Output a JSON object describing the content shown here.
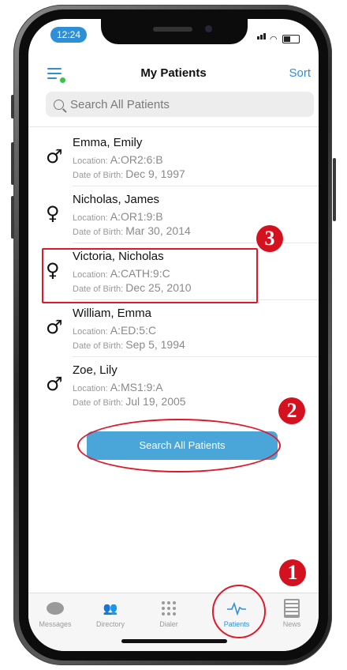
{
  "status": {
    "time": "12:24"
  },
  "header": {
    "title": "My Patients",
    "sort_label": "Sort"
  },
  "search": {
    "placeholder": "Search All Patients"
  },
  "patients": [
    {
      "sex": "male",
      "symbol": "♂",
      "name": "Emma, Emily",
      "location_label": "Location:",
      "location": "A:OR2:6:B",
      "dob_label": "Date of Birth:",
      "dob": "Dec 9, 1997"
    },
    {
      "sex": "female",
      "symbol": "♀",
      "name": "Nicholas, James",
      "location_label": "Location:",
      "location": "A:OR1:9:B",
      "dob_label": "Date of Birth:",
      "dob": "Mar 30, 2014"
    },
    {
      "sex": "female",
      "symbol": "♀",
      "name": "Victoria, Nicholas",
      "location_label": "Location:",
      "location": "A:CATH:9:C",
      "dob_label": "Date of Birth:",
      "dob": "Dec 25, 2010"
    },
    {
      "sex": "male",
      "symbol": "♂",
      "name": "William, Emma",
      "location_label": "Location:",
      "location": "A:ED:5:C",
      "dob_label": "Date of Birth:",
      "dob": "Sep 5, 1994"
    },
    {
      "sex": "male",
      "symbol": "♂",
      "name": "Zoe, Lily",
      "location_label": "Location:",
      "location": "A:MS1:9:A",
      "dob_label": "Date of Birth:",
      "dob": "Jul 19, 2005"
    }
  ],
  "search_button": {
    "label": "Search All Patients"
  },
  "annotations": {
    "badge_1": "1",
    "badge_2": "2",
    "badge_3": "3"
  },
  "tabs": [
    {
      "label": "Messages",
      "icon": "chat-bubble-icon"
    },
    {
      "label": "Directory",
      "icon": "people-icon"
    },
    {
      "label": "Dialer",
      "icon": "keypad-icon"
    },
    {
      "label": "Patients",
      "icon": "heartbeat-icon",
      "active": true
    },
    {
      "label": "News",
      "icon": "news-icon"
    }
  ],
  "colors": {
    "accent": "#2f8fd6",
    "button": "#4aa5d8",
    "annotation_red": "#e0192a"
  }
}
